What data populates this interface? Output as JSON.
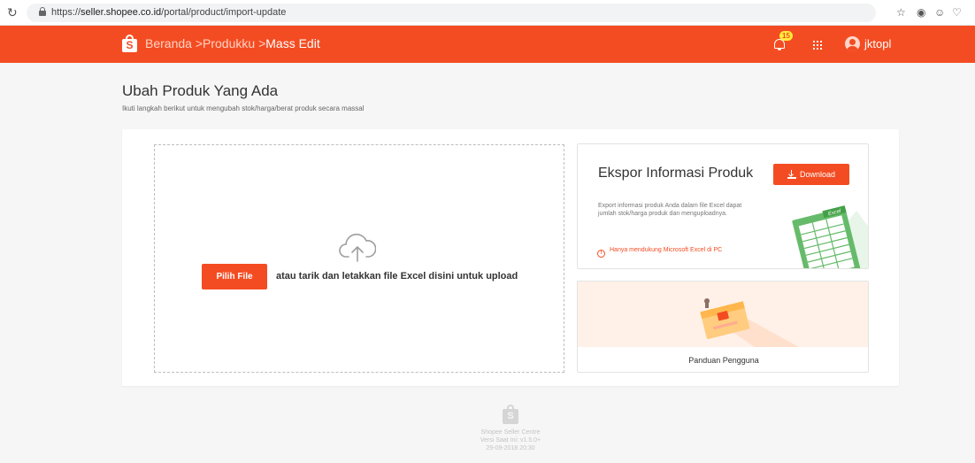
{
  "browser": {
    "reload_icon": "reload-icon",
    "url_scheme": "https://",
    "url_host": "seller.shopee.co.id",
    "url_path": "/portal/product/import-update",
    "extensions": [
      "star-icon",
      "camera-icon",
      "smiley-icon",
      "pocket-icon"
    ]
  },
  "header": {
    "logo_letter": "S",
    "breadcrumb": {
      "home": "Beranda",
      "sep1": ">",
      "products": "Produkku",
      "sep2": ">",
      "current": "Mass Edit"
    },
    "notification_count": "15",
    "username": "jktopl",
    "colors": {
      "brand": "#f44c22",
      "badge": "#ffeb3b"
    }
  },
  "page": {
    "title": "Ubah Produk Yang Ada",
    "subtitle": "Ikuti langkah berikut untuk mengubah stok/harga/berat produk secara massal"
  },
  "upload": {
    "button_label": "Pilih File",
    "drop_text": "atau tarik dan letakkan file Excel disini untuk upload"
  },
  "export": {
    "title": "Ekspor Informasi Produk",
    "download_label": "Download",
    "description": "Export informasi produk Anda dalam file Excel dapat jumlah stok/harga produk dan menguploadnya.",
    "warning": "Hanya mendukung Microsoft Excel di PC",
    "excel_badge": "Excel"
  },
  "guide": {
    "label": "Panduan Pengguna"
  },
  "footer": {
    "logo_letter": "S",
    "app_name": "Shopee Seller Centre",
    "version": "Versi Saat Ini: v1.5.0+",
    "date": "29-09-2018 20:30"
  }
}
